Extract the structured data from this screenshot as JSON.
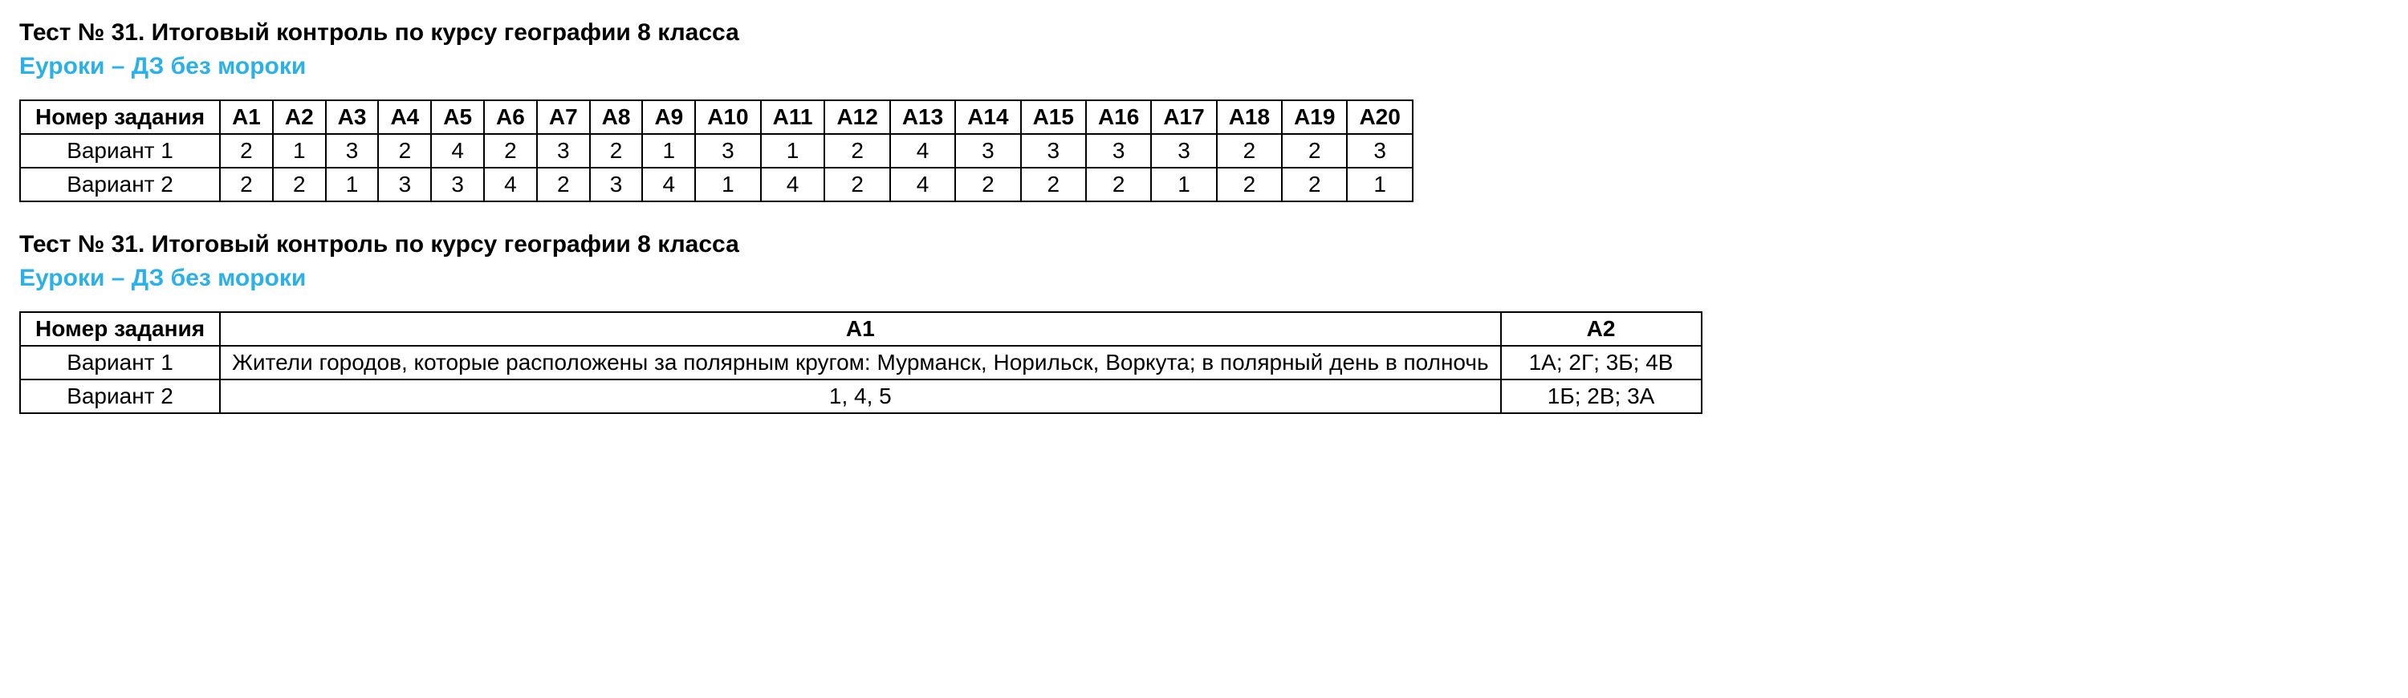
{
  "section1": {
    "title": "Тест № 31. Итоговый контроль по курсу географии 8 класса",
    "subtitle": "Еуроки – ДЗ без мороки",
    "table": {
      "header_first": "Номер задания",
      "columns": [
        "А1",
        "А2",
        "А3",
        "А4",
        "А5",
        "А6",
        "А7",
        "А8",
        "А9",
        "А10",
        "А11",
        "А12",
        "А13",
        "А14",
        "А15",
        "А16",
        "А17",
        "А18",
        "А19",
        "А20"
      ],
      "rows": [
        {
          "label": "Вариант 1",
          "values": [
            "2",
            "1",
            "3",
            "2",
            "4",
            "2",
            "3",
            "2",
            "1",
            "3",
            "1",
            "2",
            "4",
            "3",
            "3",
            "3",
            "3",
            "2",
            "2",
            "3"
          ]
        },
        {
          "label": "Вариант 2",
          "values": [
            "2",
            "2",
            "1",
            "3",
            "3",
            "4",
            "2",
            "3",
            "4",
            "1",
            "4",
            "2",
            "4",
            "2",
            "2",
            "2",
            "1",
            "2",
            "2",
            "1"
          ]
        }
      ]
    }
  },
  "section2": {
    "title": "Тест № 31. Итоговый контроль по курсу географии 8 класса",
    "subtitle": "Еуроки – ДЗ без мороки",
    "table": {
      "header_first": "Номер задания",
      "columns": [
        "А1",
        "А2"
      ],
      "rows": [
        {
          "label": "Вариант 1",
          "values": [
            "Жители городов, которые расположены за полярным кругом: Мурманск, Норильск, Воркута; в полярный день в полночь",
            "1А; 2Г; 3Б; 4В"
          ]
        },
        {
          "label": "Вариант 2",
          "values": [
            "1, 4, 5",
            "1Б; 2В; 3А"
          ]
        }
      ]
    }
  }
}
